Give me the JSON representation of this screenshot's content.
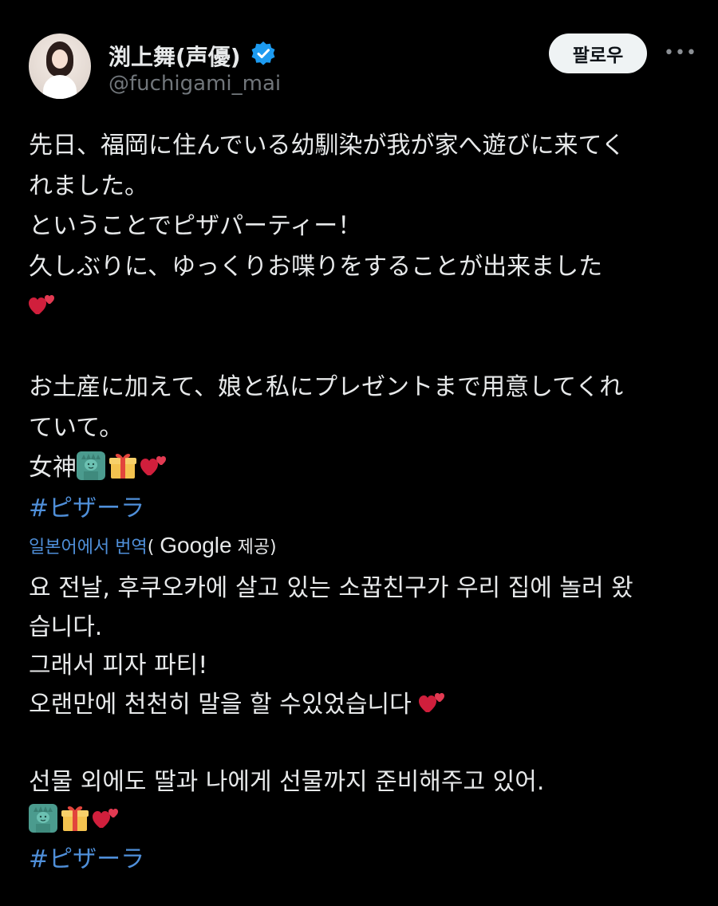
{
  "author": {
    "display_name": "渕上舞(声優)",
    "handle": "@fuchigami_mai",
    "verified": true
  },
  "actions": {
    "follow_label": "팔로우",
    "more_label": "•••"
  },
  "tweet": {
    "lines": [
      "先日、福岡に住んでいる幼馴染が我が家へ遊びに来てく",
      "れました。",
      "ということでピザパーティー！",
      "久しぶりに、ゆっくりお喋りをすることが出来ました"
    ],
    "lines2": [
      "お土産に加えて、娘と私にプレゼントまで用意してくれ",
      "ていて。"
    ],
    "goddess_text": "女神",
    "hashtag": "#ピザーラ"
  },
  "translation_notice": {
    "link": "일본어에서 번역",
    "paren_open": "(",
    "provider": "Google",
    "provided": "제공)"
  },
  "translation": {
    "lines": [
      "요 전날, 후쿠오카에 살고 있는 소꿉친구가 우리 집에 놀러 왔",
      "습니다.",
      "그래서 피자 파티!",
      "오랜만에 천천히 말을 할 수있었습니다"
    ],
    "lines2": [
      "선물 외에도 딸과 나에게 선물까지 준비해주고 있어."
    ],
    "hashtag": "#ピザーラ"
  },
  "icons": {
    "verified": "verified-badge-icon",
    "more": "more-horizontal-icon",
    "hearts": "two-hearts-emoji",
    "statue": "statue-of-liberty-emoji",
    "gift": "wrapped-gift-emoji"
  },
  "colors": {
    "background": "#000000",
    "text": "#e7e9ea",
    "secondary_text": "#71767b",
    "link": "#4f8fd9",
    "verified": "#1d9bf0",
    "follow_bg": "#eff3f4"
  }
}
